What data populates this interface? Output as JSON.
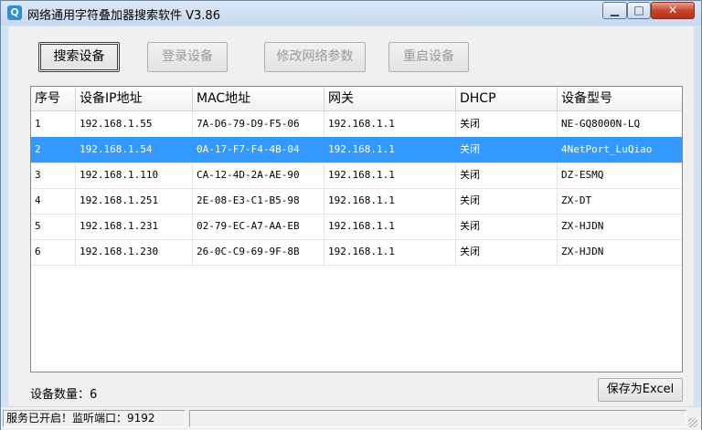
{
  "window": {
    "title": "网络通用字符叠加器搜索软件 V3.86",
    "minimize_glyph": "▁",
    "maximize_glyph": "□",
    "close_glyph": "✕"
  },
  "toolbar": {
    "search_label": "搜索设备",
    "login_label": "登录设备",
    "modify_network_label": "修改网络参数",
    "restart_label": "重启设备"
  },
  "table": {
    "columns": [
      "序号",
      "设备IP地址",
      "MAC地址",
      "网关",
      "DHCP",
      "设备型号"
    ],
    "rows": [
      [
        "1",
        "192.168.1.55",
        "7A-D6-79-D9-F5-06",
        "192.168.1.1",
        "关闭",
        "NE-GQ8000N-LQ"
      ],
      [
        "2",
        "192.168.1.54",
        "0A-17-F7-F4-4B-04",
        "192.168.1.1",
        "关闭",
        "4NetPort_LuQiao"
      ],
      [
        "3",
        "192.168.1.110",
        "CA-12-4D-2A-AE-90",
        "192.168.1.1",
        "关闭",
        "DZ-ESMQ"
      ],
      [
        "4",
        "192.168.1.251",
        "2E-08-E3-C1-B5-98",
        "192.168.1.1",
        "关闭",
        "ZX-DT"
      ],
      [
        "5",
        "192.168.1.231",
        "02-79-EC-A7-AA-EB",
        "192.168.1.1",
        "关闭",
        "ZX-HJDN"
      ],
      [
        "6",
        "192.168.1.230",
        "26-0C-C9-69-9F-8B",
        "192.168.1.1",
        "关闭",
        "ZX-HJDN"
      ]
    ],
    "selected_row": 2
  },
  "footer": {
    "device_count_label": "设备数量：6",
    "save_excel_label": "保存为Excel"
  },
  "statusbar": {
    "status_text": "服务已开启！监听端口：9192"
  },
  "colors": {
    "selection": "#3399ff",
    "title_bar": "#c7d9ef",
    "close_button": "#c7452c"
  }
}
